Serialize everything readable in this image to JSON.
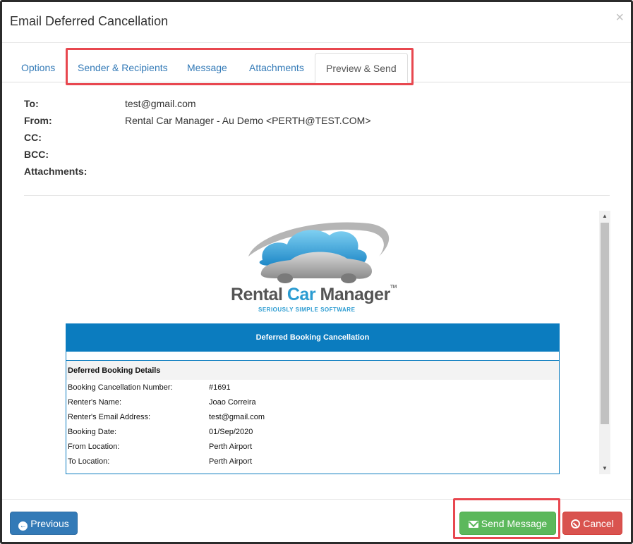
{
  "dialog": {
    "title": "Email Deferred Cancellation",
    "close_glyph": "×"
  },
  "tabs": [
    {
      "label": "Options"
    },
    {
      "label": "Sender & Recipients"
    },
    {
      "label": "Message"
    },
    {
      "label": "Attachments"
    },
    {
      "label": "Preview & Send",
      "active": true
    }
  ],
  "headers": {
    "to_label": "To:",
    "to_value": "test@gmail.com",
    "from_label": "From:",
    "from_value": "Rental Car Manager - Au Demo <PERTH@TEST.COM>",
    "cc_label": "CC:",
    "cc_value": "",
    "bcc_label": "BCC:",
    "bcc_value": "",
    "attachments_label": "Attachments:",
    "attachments_value": ""
  },
  "email": {
    "logo": {
      "word1": "Rental ",
      "word2": "Car",
      "word3": " Manager",
      "tm": "TM",
      "tagline": "SERIOUSLY SIMPLE SOFTWARE"
    },
    "banner_title": "Deferred Booking Cancellation",
    "section_title": "Deferred Booking Details",
    "details": [
      {
        "label": "Booking Cancellation Number:",
        "value": "#1691"
      },
      {
        "label": "Renter's Name:",
        "value": "Joao Correira"
      },
      {
        "label": "Renter's Email Address:",
        "value": "test@gmail.com"
      },
      {
        "label": "Booking Date:",
        "value": "01/Sep/2020"
      },
      {
        "label": "From Location:",
        "value": "Perth Airport"
      },
      {
        "label": "To Location:",
        "value": "Perth Airport"
      }
    ]
  },
  "footer": {
    "previous_label": "Previous",
    "send_label": "Send Message",
    "cancel_label": "Cancel"
  },
  "colors": {
    "primary": "#337ab7",
    "success": "#5cb85c",
    "danger": "#d9534f",
    "highlight": "#e8474f",
    "email_banner": "#0b7cbf"
  },
  "icons": {
    "close": "close-icon",
    "previous": "arrow-circle-left-icon",
    "send": "envelope-icon",
    "cancel": "ban-icon"
  }
}
